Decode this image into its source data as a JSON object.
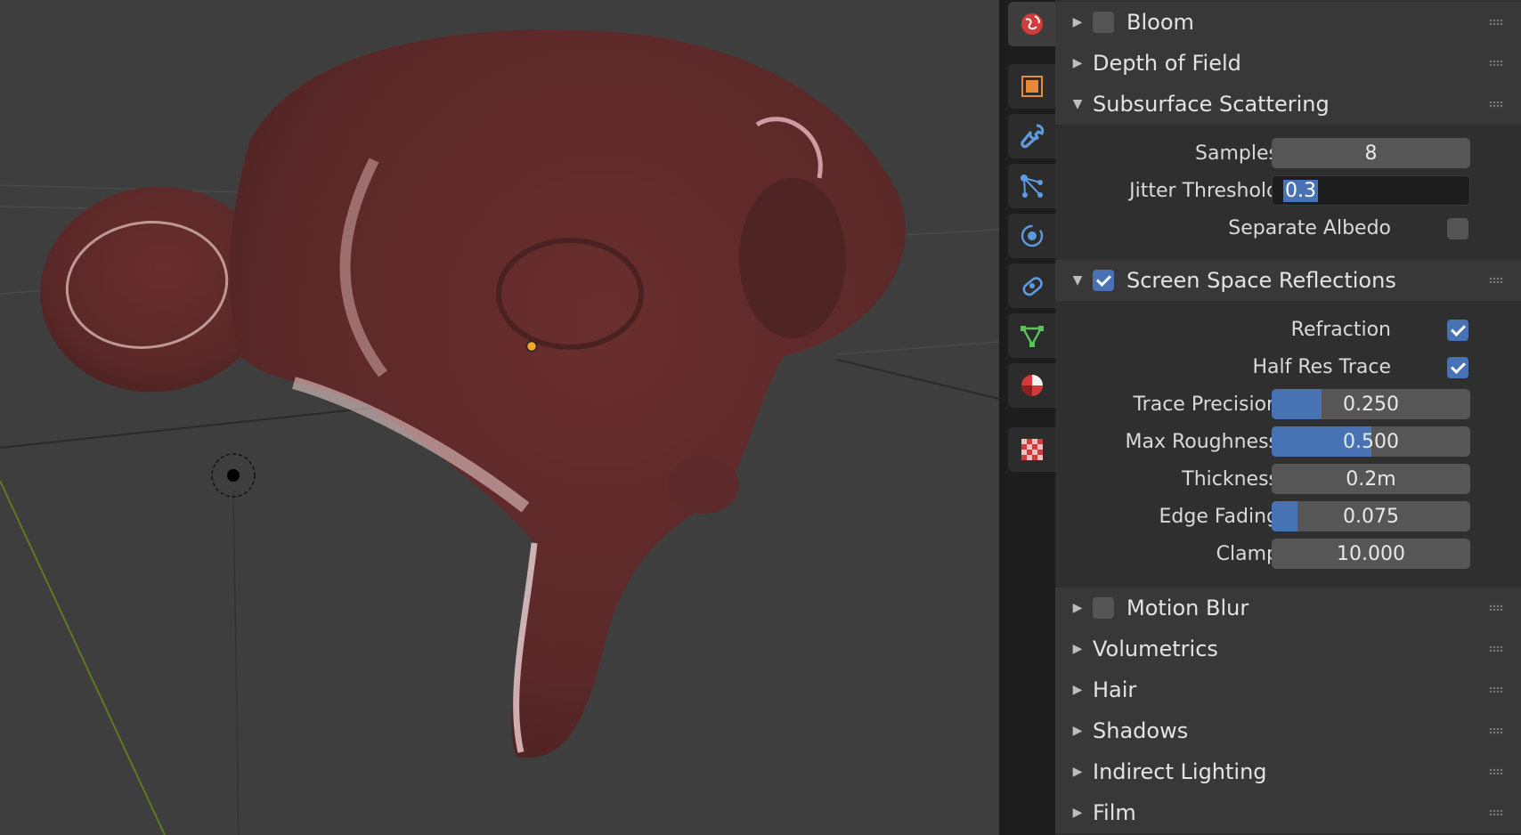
{
  "colors": {
    "accent": "#4772b3",
    "panel_bg": "#303030",
    "header_bg": "#383838",
    "viewport_bg": "#3e3e3e",
    "mesh": "#5a2a2a"
  },
  "tabs": [
    {
      "icon": "world-icon",
      "active": true
    },
    {
      "icon": "object-icon"
    },
    {
      "icon": "wrench-icon"
    },
    {
      "icon": "particles-icon"
    },
    {
      "icon": "physics-icon"
    },
    {
      "icon": "constraints-icon"
    },
    {
      "icon": "object-data-icon"
    },
    {
      "icon": "material-icon"
    },
    {
      "icon": "texture-icon"
    }
  ],
  "panels": {
    "bloom": {
      "label": "Bloom",
      "enabled": false
    },
    "depth_of_field": {
      "label": "Depth of Field"
    },
    "subsurface": {
      "label": "Subsurface Scattering",
      "samples_label": "Samples",
      "samples_value": "8",
      "jitter_label": "Jitter Threshold",
      "jitter_value": "0.3",
      "albedo_label": "Separate Albedo",
      "albedo_checked": false
    },
    "ssr": {
      "label": "Screen Space Reflections",
      "enabled": true,
      "refraction_label": "Refraction",
      "refraction_checked": true,
      "halfres_label": "Half Res Trace",
      "halfres_checked": true,
      "trace_label": "Trace Precision",
      "trace_value": "0.250",
      "trace_fill": 0.25,
      "rough_label": "Max Roughness",
      "rough_value": "0.500",
      "rough_fill": 0.5,
      "thick_label": "Thickness",
      "thick_value": "0.2m",
      "edge_label": "Edge Fading",
      "edge_value": "0.075",
      "edge_fill": 0.13,
      "clamp_label": "Clamp",
      "clamp_value": "10.000"
    },
    "motion_blur": {
      "label": "Motion Blur",
      "enabled": false
    },
    "volumetrics": {
      "label": "Volumetrics"
    },
    "hair": {
      "label": "Hair"
    },
    "shadows": {
      "label": "Shadows"
    },
    "indirect": {
      "label": "Indirect Lighting"
    },
    "film": {
      "label": "Film"
    }
  }
}
